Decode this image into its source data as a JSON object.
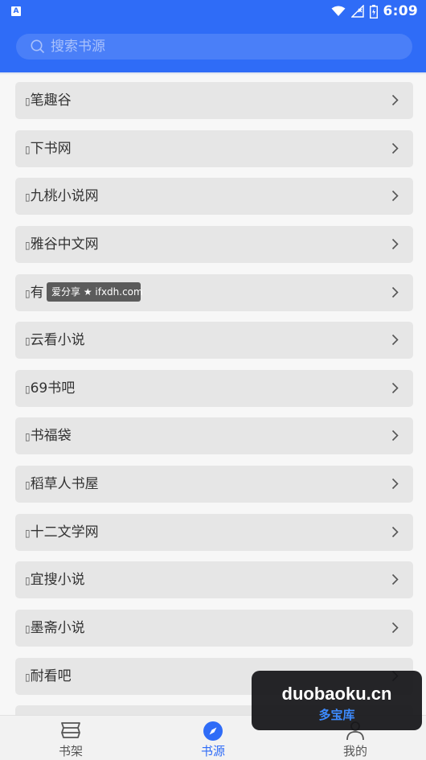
{
  "status_bar": {
    "app_badge": "A",
    "time": "6:09"
  },
  "search": {
    "placeholder": "搜索书源",
    "value": ""
  },
  "sources": [
    {
      "icon": "▯",
      "name": "笔趣谷"
    },
    {
      "icon": "▯",
      "name": "下书网"
    },
    {
      "icon": "▯",
      "name": "九桃小说网"
    },
    {
      "icon": "▯",
      "name": "雅谷中文网"
    },
    {
      "icon": "▯",
      "name": "有"
    },
    {
      "icon": "▯",
      "name": "云看小说"
    },
    {
      "icon": "▯",
      "name": "69书吧"
    },
    {
      "icon": "▯",
      "name": "书福袋"
    },
    {
      "icon": "▯",
      "name": "稻草人书屋"
    },
    {
      "icon": "▯",
      "name": "十二文学网"
    },
    {
      "icon": "▯",
      "name": "宜搜小说"
    },
    {
      "icon": "▯",
      "name": "墨斋小说"
    },
    {
      "icon": "▯",
      "name": "耐看吧"
    },
    {
      "icon": "",
      "name": ""
    }
  ],
  "watermark": "爱分享 ★ ifxdh.com",
  "tabs": [
    {
      "label": "书架",
      "icon": "bookshelf-icon"
    },
    {
      "label": "书源",
      "icon": "compass-icon"
    },
    {
      "label": "我的",
      "icon": "profile-icon"
    }
  ],
  "active_tab": "书源",
  "brand": {
    "title": "duobaoku.cn",
    "subtitle": "多宝库"
  },
  "colors": {
    "primary": "#2f6cf7",
    "item_background": "#e6e6e6",
    "tab_active": "#2f6cf7"
  }
}
